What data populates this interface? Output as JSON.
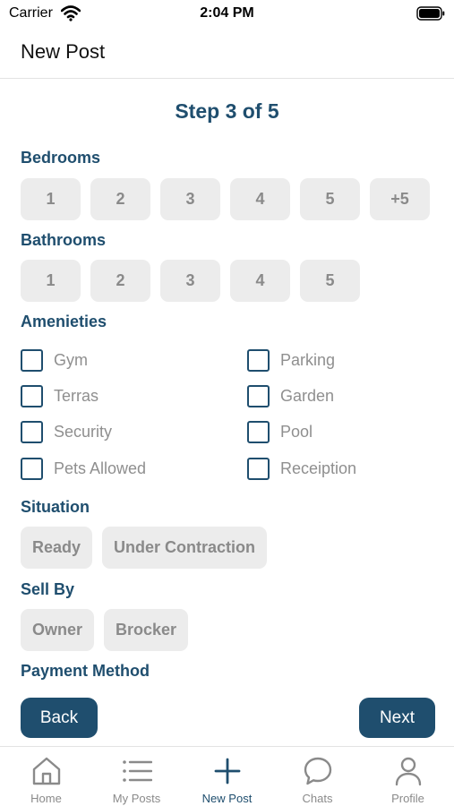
{
  "status_bar": {
    "carrier": "Carrier",
    "time": "2:04 PM"
  },
  "header": {
    "title": "New Post"
  },
  "step": {
    "title": "Step 3 of 5"
  },
  "bedrooms": {
    "label": "Bedrooms",
    "options": [
      "1",
      "2",
      "3",
      "4",
      "5",
      "+5"
    ]
  },
  "bathrooms": {
    "label": "Bathrooms",
    "options": [
      "1",
      "2",
      "3",
      "4",
      "5"
    ]
  },
  "amenities": {
    "label": "Amenieties",
    "left": [
      "Gym",
      "Terras",
      "Security",
      "Pets Allowed"
    ],
    "right": [
      "Parking",
      "Garden",
      "Pool",
      "Receiption"
    ]
  },
  "situation": {
    "label": "Situation",
    "options": [
      "Ready",
      "Under Contraction"
    ]
  },
  "sell_by": {
    "label": "Sell By",
    "options": [
      "Owner",
      "Brocker"
    ]
  },
  "payment": {
    "label": "Payment Method"
  },
  "buttons": {
    "back": "Back",
    "next": "Next"
  },
  "tabs": [
    {
      "label": "Home",
      "icon": "home-icon"
    },
    {
      "label": "My Posts",
      "icon": "list-icon"
    },
    {
      "label": "New Post",
      "icon": "plus-icon",
      "active": true
    },
    {
      "label": "Chats",
      "icon": "chat-bubble-icon"
    },
    {
      "label": "Profile",
      "icon": "person-icon"
    }
  ],
  "colors": {
    "accent": "#1f4e6e",
    "chip_bg": "#ececec",
    "muted_text": "#8a8a8a"
  }
}
